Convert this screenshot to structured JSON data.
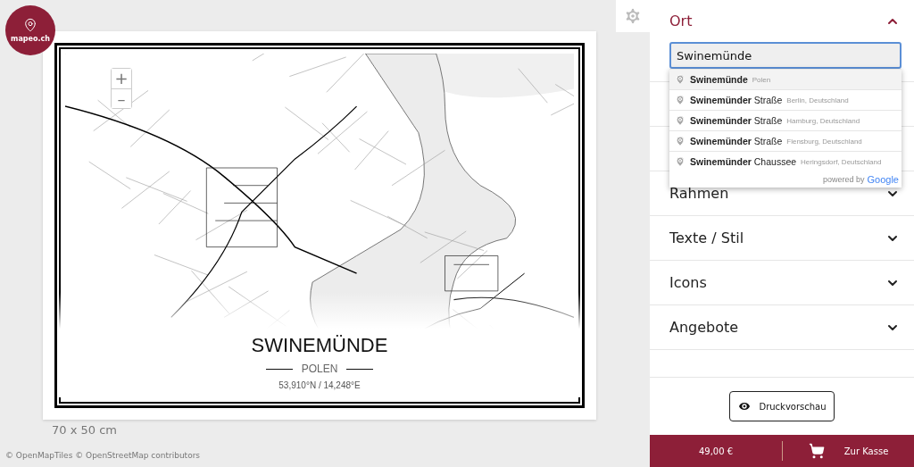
{
  "logo": {
    "text": "mapeo.ch"
  },
  "map": {
    "zoom_in": "+",
    "zoom_out": "–",
    "title": "SWINEMÜNDE",
    "subtitle": "POLEN",
    "coords": "53,910°N / 14,248°E",
    "size": "70 x 50 cm",
    "attribution": "© OpenMapTiles © OpenStreetMap contributors"
  },
  "sections": [
    {
      "title": "Ort",
      "expanded": true,
      "search": {
        "value": "Swinemünde",
        "suggestions": [
          {
            "text": "**Swinemünde**",
            "secondary": "Polen",
            "selected": true
          },
          {
            "text": "**Swinemünder** Straße",
            "secondary": "Berlin, Deutschland",
            "selected": false
          },
          {
            "text": "**Swinemünder** Straße",
            "secondary": "Hamburg, Deutschland",
            "selected": false
          },
          {
            "text": "**Swinemünder** Straße",
            "secondary": "Flensburg, Deutschland",
            "selected": false
          },
          {
            "text": "**Swinemünder** Chaussee",
            "secondary": "Heringsdorf, Deutschland",
            "selected": false
          }
        ],
        "powered_by": "powered by",
        "brand": "Google"
      }
    },
    {
      "title": "Rahmen",
      "expanded": false
    },
    {
      "title": "Texte / Stil",
      "expanded": false
    },
    {
      "title": "Icons",
      "expanded": false
    },
    {
      "title": "Angebote",
      "expanded": false
    }
  ],
  "preview_button": "Druckvorschau",
  "footer": {
    "price": "49,00 €",
    "checkout": "Zur Kasse"
  }
}
